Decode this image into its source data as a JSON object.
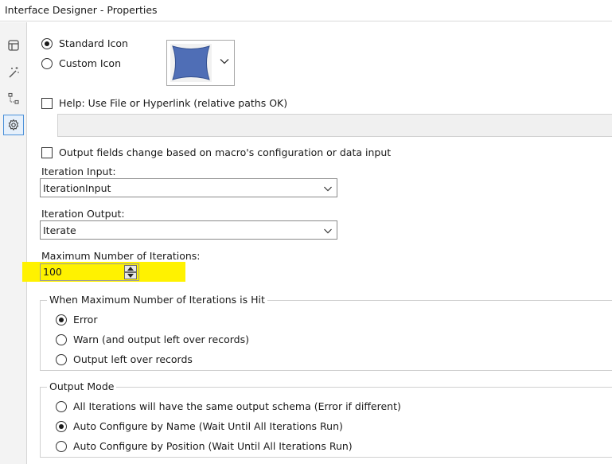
{
  "window": {
    "title": "Interface Designer - Properties"
  },
  "toolbar": [
    {
      "icon": "layout-icon"
    },
    {
      "icon": "magic-wand-icon"
    },
    {
      "icon": "tree-icon"
    },
    {
      "icon": "gear-icon",
      "active": true
    }
  ],
  "icon_choice": {
    "standard_label": "Standard Icon",
    "custom_label": "Custom Icon",
    "selected": "standard",
    "preview_color": "#4f6eb6"
  },
  "help": {
    "label": "Help: Use File or Hyperlink (relative paths OK)",
    "checked": false,
    "value": ""
  },
  "output_fields": {
    "label": "Output fields change based on macro's configuration or data input",
    "checked": false
  },
  "iteration_input": {
    "label": "Iteration Input:",
    "value": "IterationInput"
  },
  "iteration_output": {
    "label": "Iteration Output:",
    "value": "Iterate"
  },
  "max_iterations": {
    "label": "Maximum Number of Iterations:",
    "value": "100",
    "highlight_color": "#fff200"
  },
  "max_hit_group": {
    "title": "When Maximum Number of Iterations is Hit",
    "options": [
      {
        "label": "Error",
        "selected": true
      },
      {
        "label": "Warn (and output left over records)",
        "selected": false
      },
      {
        "label": "Output left over records",
        "selected": false
      }
    ]
  },
  "output_mode_group": {
    "title": "Output Mode",
    "options": [
      {
        "label": "All Iterations will have the same output schema (Error if different)",
        "selected": false
      },
      {
        "label": "Auto Configure by Name (Wait Until All Iterations Run)",
        "selected": true
      },
      {
        "label": "Auto Configure by Position (Wait Until All Iterations Run)",
        "selected": false
      }
    ]
  }
}
